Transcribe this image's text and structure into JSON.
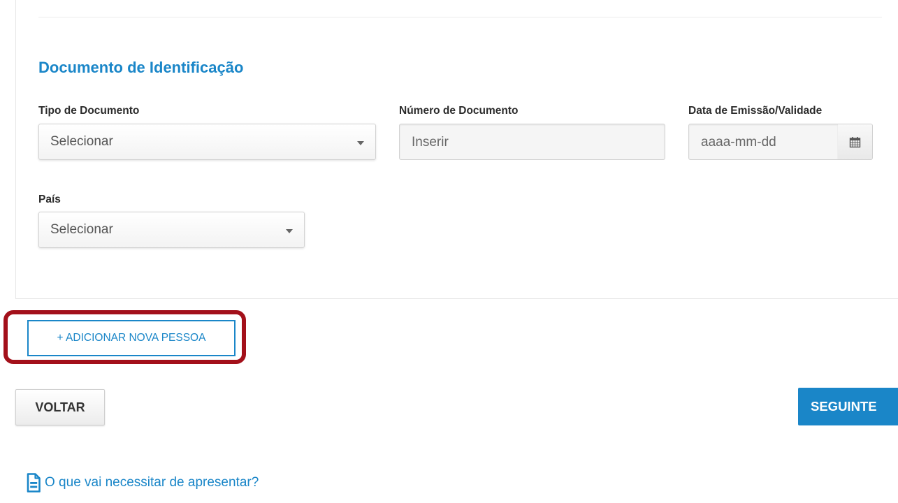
{
  "section": {
    "title": "Documento de Identificação"
  },
  "fields": {
    "document_type": {
      "label": "Tipo de Documento",
      "value": "Selecionar"
    },
    "document_number": {
      "label": "Número de Documento",
      "placeholder": "Inserir"
    },
    "issue_date": {
      "label": "Data de Emissão/Validade",
      "placeholder": "aaaa-mm-dd",
      "icon": "calendar-icon"
    },
    "country": {
      "label": "País",
      "value": "Selecionar"
    }
  },
  "actions": {
    "add_person": "+ ADICIONAR NOVA PESSOA",
    "back": "VOLTAR",
    "next": "SEGUINTE"
  },
  "help": {
    "icon": "document-icon",
    "text": "O que vai necessitar de apresentar?"
  },
  "colors": {
    "accent": "#1a86c8",
    "highlight": "#a3101a"
  }
}
